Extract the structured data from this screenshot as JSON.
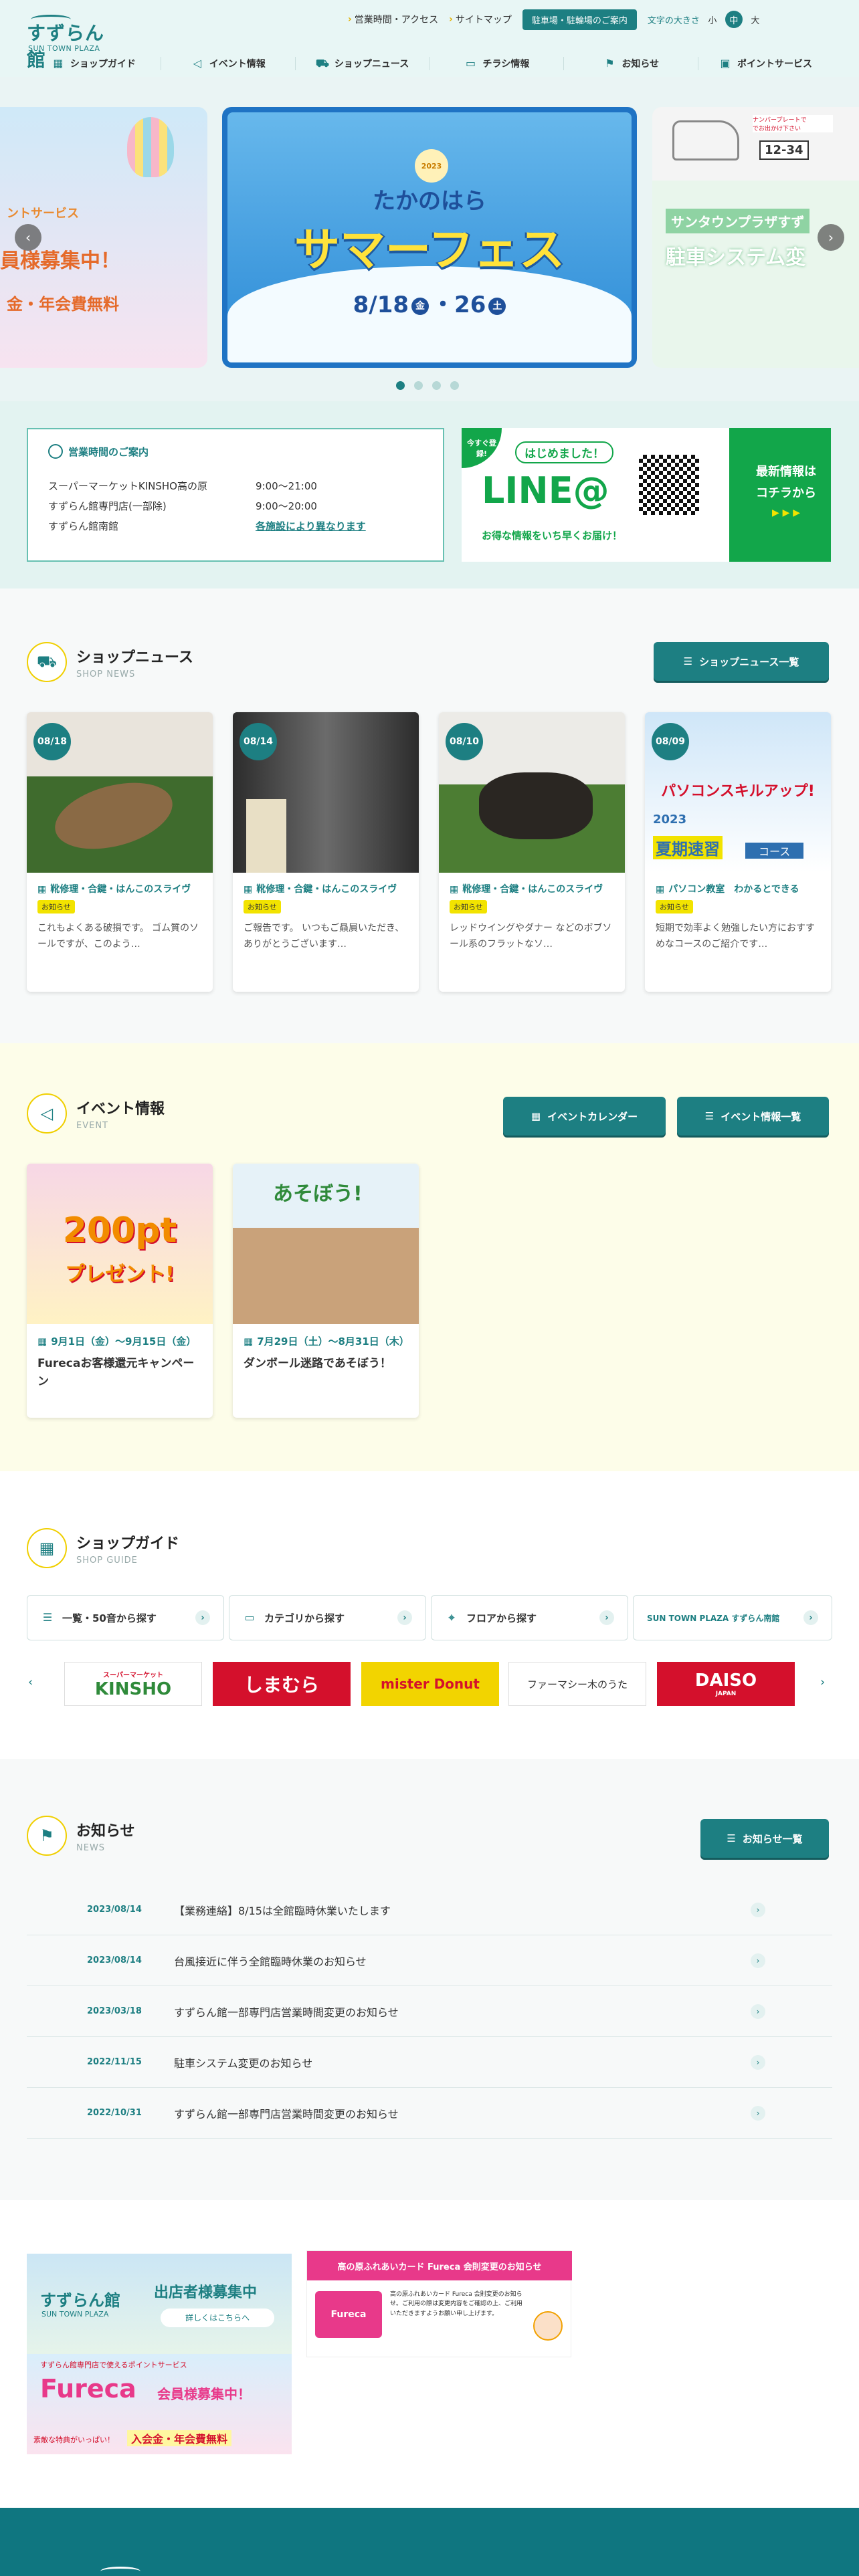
{
  "header": {
    "logo_text": "すずらん館",
    "logo_sub": "SUN TOWN PLAZA",
    "utility_links": [
      "営業時間・アクセス",
      "サイトマップ"
    ],
    "parking_button": "駐車場・駐輪場のご案内",
    "font_size_label": "文字の大きさ",
    "font_sizes": [
      "小",
      "中",
      "大"
    ],
    "nav": [
      {
        "label": "ショップガイド",
        "icon": "calendar-icon"
      },
      {
        "label": "イベント情報",
        "icon": "megaphone-icon"
      },
      {
        "label": "ショップニュース",
        "icon": "cart-icon"
      },
      {
        "label": "チラシ情報",
        "icon": "flyer-icon"
      },
      {
        "label": "お知らせ",
        "icon": "flag-icon"
      },
      {
        "label": "ポイントサービス",
        "icon": "card-icon"
      }
    ]
  },
  "hero": {
    "left_slide": {
      "line1": "ントサービス",
      "line2": "員様募集中！",
      "line3": "金・年会費無料"
    },
    "center_slide": {
      "year": "2023",
      "title_top": "たかのはら",
      "title_main": "サマーフェス",
      "dates": "8/18",
      "dates_dow1": "金",
      "dates_sep": "・",
      "dates2": "26",
      "dates_dow2": "土"
    },
    "right_slide": {
      "line1": "サンタウンプラザすず",
      "line2": "駐車システム変",
      "sign": "12-34",
      "top_note": "ナンバープレートで\nでお出かけ下さい"
    }
  },
  "hours": {
    "title": "営業時間のご案内",
    "rows": [
      {
        "name": "スーパーマーケットKINSHO高の原",
        "time": "9:00〜21:00"
      },
      {
        "name": "すずらん館専門店(一部除)",
        "time": "9:00〜20:00"
      },
      {
        "name": "すずらん館南館",
        "time": "各施設により異なります"
      }
    ]
  },
  "line_banner": {
    "badge": "今すぐ登録!",
    "hello": "はじめました！",
    "logo": "LINE@",
    "sub": "お得な情報をいち早くお届け！",
    "right1": "最新情報は",
    "right2": "コチラから",
    "right3": "▶ ▶ ▶"
  },
  "shop_news": {
    "title": "ショップニュース",
    "subtitle": "SHOP NEWS",
    "button": "ショップニュース一覧",
    "cards": [
      {
        "date": "08/18",
        "shop": "靴修理・合鍵・はんこのスライヴ",
        "tag": "お知らせ",
        "desc": "これもよくある破損です。 ゴム質のソールですが、このよう…",
        "img": "#5b4a3a"
      },
      {
        "date": "08/14",
        "shop": "靴修理・合鍵・はんこのスライヴ",
        "tag": "お知らせ",
        "desc": "ご報告です。 いつもご贔屓いただき、ありがとうございます…",
        "img": "#4a4a4a"
      },
      {
        "date": "08/10",
        "shop": "靴修理・合鍵・はんこのスライヴ",
        "tag": "お知らせ",
        "desc": "レッドウイングやダナー などのボブソール系のフラットなソ…",
        "img": "#3d3a35"
      },
      {
        "date": "08/09",
        "shop": "パソコン教室　わかるとできる",
        "tag": "お知らせ",
        "desc": "短期で効率よく勉強したい方におすすめなコースのご紹介です…",
        "img": "#2e6fb0",
        "img_line1": "パソコンスキルアップ!",
        "img_line2": "2023",
        "img_line3": "夏期速習",
        "img_line4": "コース"
      }
    ]
  },
  "events": {
    "title": "イベント情報",
    "subtitle": "EVENT",
    "calendar_button": "イベントカレンダー",
    "list_button": "イベント情報一覧",
    "cards": [
      {
        "date": "9月1日（金）〜9月15日（金）",
        "title": "Furecaお客様還元キャンペーン",
        "img_main": "200pt",
        "img_sub": "プレゼント!"
      },
      {
        "date": "7月29日（土）〜8月31日（木）",
        "title": "ダンボール迷路であそぼう！",
        "img_main": "あそぼう!"
      }
    ]
  },
  "shop_guide": {
    "title": "ショップガイド",
    "subtitle": "SHOP GUIDE",
    "buttons": [
      {
        "label": "一覧・50音から探す",
        "icon": "list-icon"
      },
      {
        "label": "カテゴリから探す",
        "icon": "folder-icon"
      },
      {
        "label": "フロアから探す",
        "icon": "pin-icon"
      },
      {
        "label": "SUN TOWN PLAZA すずらん南館",
        "icon": ""
      }
    ],
    "logos": [
      {
        "name": "KINSHO",
        "sub": "スーパーマーケット",
        "bg": "#ffffff",
        "fg": "#d4161d"
      },
      {
        "name": "しまむら",
        "bg": "#d4102c",
        "fg": "#ffffff"
      },
      {
        "name": "mister Donut",
        "bg": "#f2d400",
        "fg": "#d4102c"
      },
      {
        "name": "ファーマシー木のうた",
        "bg": "#ffffff",
        "fg": "#333333"
      },
      {
        "name": "DAISO",
        "sub": "JAPAN",
        "bg": "#d4102c",
        "fg": "#ffffff"
      }
    ]
  },
  "news": {
    "title": "お知らせ",
    "subtitle": "NEWS",
    "button": "お知らせ一覧",
    "items": [
      {
        "date": "2023/08/14",
        "title": "【業務連絡】8/15は全館臨時休業いたします"
      },
      {
        "date": "2023/08/14",
        "title": "台風接近に伴う全館臨時休業のお知らせ"
      },
      {
        "date": "2023/03/18",
        "title": "すずらん館一部専門店営業時間変更のお知らせ"
      },
      {
        "date": "2022/11/15",
        "title": "駐車システム変更のお知らせ"
      },
      {
        "date": "2022/10/31",
        "title": "すずらん館一部専門店営業時間変更のお知らせ"
      }
    ]
  },
  "banners": {
    "tenant_logo": "すずらん館",
    "tenant_sub": "SUN TOWN PLAZA",
    "tenant_title": "出店者様募集中",
    "tenant_link": "詳しくはこちらへ",
    "fureca_top": "すずらん館専門店で使えるポイントサービス",
    "fureca_logo": "Fureca",
    "fureca_title": "会員様募集中！",
    "fureca_bottom": "素敵な特典がいっぱい！",
    "fureca_free": "入会金・年会費無料",
    "card_title": "高の原ふれあいカード Fureca 会則変更のお知らせ",
    "card_text": "高の原ふれあいカード Fureca 会則変更のお知らせ。ご利用の際は変更内容をご確認の上、ご利用いただきますようお願い申し上げます。"
  }
}
